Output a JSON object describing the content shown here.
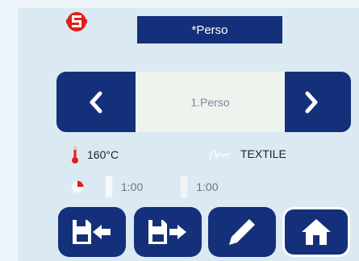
{
  "header": {
    "title": "*Perso",
    "logo_name": "brand-logo"
  },
  "selector": {
    "value": "1.Perso",
    "prev_icon": "chevron-left-icon",
    "next_icon": "chevron-right-icon"
  },
  "status": {
    "temperature": "160°C",
    "material": "TEXTILE",
    "time_upper": "1:00",
    "time_lower": "1:00"
  },
  "actions": [
    {
      "name": "import-button",
      "icon": "file-import-icon"
    },
    {
      "name": "export-button",
      "icon": "file-export-icon"
    },
    {
      "name": "edit-button",
      "icon": "pencil-icon"
    },
    {
      "name": "home-button",
      "icon": "home-icon"
    }
  ],
  "colors": {
    "primary": "#15307a",
    "screen_bg": "#dbe9f2",
    "accent_red": "#e0201d",
    "value_bg": "#eef3ee"
  }
}
